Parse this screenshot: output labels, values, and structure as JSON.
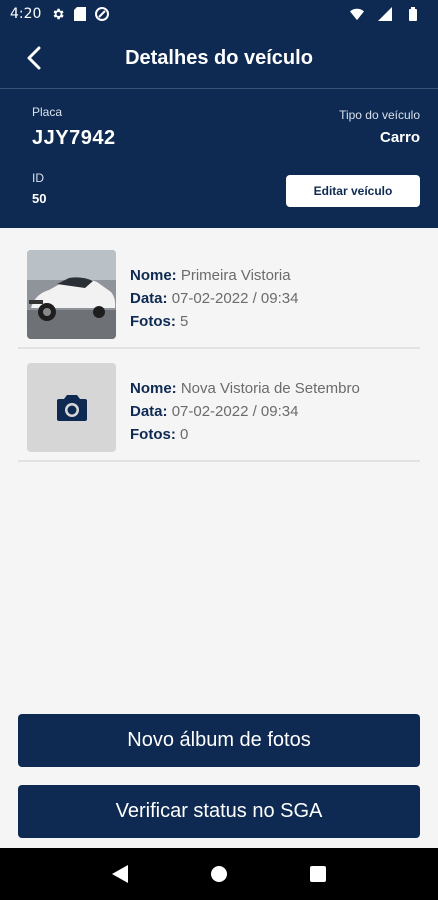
{
  "status_bar": {
    "time": "4:20",
    "left_icons": [
      "gear-icon",
      "sd-card-icon",
      "sync-icon"
    ],
    "right_icons": [
      "wifi-icon",
      "signal-icon",
      "battery-icon"
    ]
  },
  "app_bar": {
    "title": "Detalhes do veículo",
    "back_icon": "chevron-left-icon"
  },
  "vehicle": {
    "plate_label": "Placa",
    "plate": "JJY7942",
    "type_label": "Tipo do veículo",
    "type": "Carro",
    "id_label": "ID",
    "id": "50",
    "edit_label": "Editar veículo"
  },
  "albums": [
    {
      "name_key": "Nome:",
      "name": "Primeira Vistoria",
      "date_key": "Data:",
      "date": "07-02-2022 / 09:34",
      "photos_key": "Fotos:",
      "photos": "5",
      "thumbnail": "car-photo"
    },
    {
      "name_key": "Nome:",
      "name": "Nova Vistoria de Setembro",
      "date_key": "Data:",
      "date": "07-02-2022 / 09:34",
      "photos_key": "Fotos:",
      "photos": "0",
      "thumbnail": "camera-icon"
    }
  ],
  "actions": {
    "new_album": "Novo álbum de fotos",
    "check_status": "Verificar status no SGA"
  },
  "nav_bar": {
    "icons": [
      "back-triangle-icon",
      "home-circle-icon",
      "recents-square-icon"
    ]
  },
  "colors": {
    "primary": "#0e2a52",
    "background": "#f5f5f5",
    "placeholder": "#d6d6d6"
  }
}
